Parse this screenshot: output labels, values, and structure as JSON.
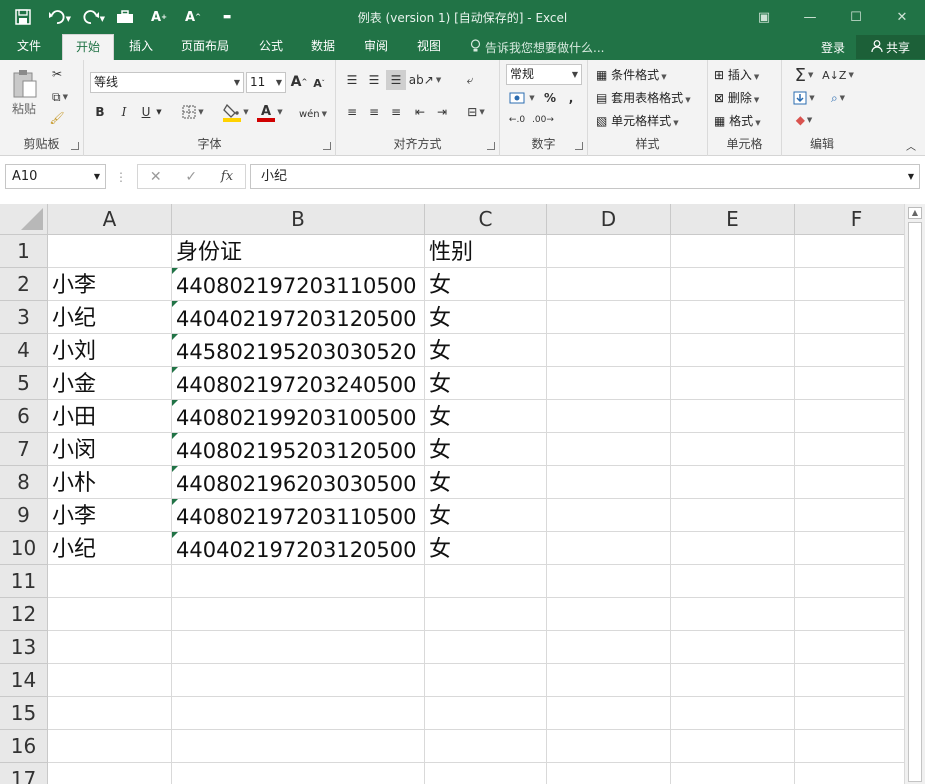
{
  "window": {
    "title": "例表 (version 1) [自动保存的] - Excel"
  },
  "tabs": [
    "文件",
    "开始",
    "插入",
    "页面布局",
    "公式",
    "数据",
    "审阅",
    "视图"
  ],
  "active_tab": "开始",
  "tell_me": "告诉我您想要做什么...",
  "account": {
    "login": "登录",
    "share": "共享"
  },
  "ribbon": {
    "clipboard": {
      "paste": "粘贴",
      "label": "剪贴板"
    },
    "font": {
      "name": "等线",
      "size": "11",
      "label": "字体",
      "bold": "B",
      "italic": "I",
      "underline": "U"
    },
    "alignment": {
      "label": "对齐方式"
    },
    "number": {
      "format": "常规",
      "percent": "%",
      "comma": ",",
      "label": "数字"
    },
    "styles": {
      "conditional": "条件格式",
      "table": "套用表格格式",
      "cell": "单元格样式",
      "label": "样式"
    },
    "cells": {
      "insert": "插入",
      "delete": "删除",
      "format": "格式",
      "label": "单元格"
    },
    "editing": {
      "label": "编辑"
    }
  },
  "formula_bar": {
    "name_box": "A10",
    "fx": "fx",
    "content": "小纪"
  },
  "columns": [
    "A",
    "B",
    "C",
    "D",
    "E",
    "F"
  ],
  "rows": [
    "1",
    "2",
    "3",
    "4",
    "5",
    "6",
    "7",
    "8",
    "9",
    "10",
    "11",
    "12",
    "13",
    "14",
    "15",
    "16",
    "17"
  ],
  "cells": [
    [
      "",
      "身份证",
      "性别"
    ],
    [
      "小李",
      "440802197203110500",
      "女"
    ],
    [
      "小纪",
      "440402197203120500",
      "女"
    ],
    [
      "小刘",
      "445802195203030520",
      "女"
    ],
    [
      "小金",
      "440802197203240500",
      "女"
    ],
    [
      "小田",
      "440802199203100500",
      "女"
    ],
    [
      "小闵",
      "440802195203120500",
      "女"
    ],
    [
      "小朴",
      "440802196203030500",
      "女"
    ],
    [
      "小李",
      "440802197203110500",
      "女"
    ],
    [
      "小纪",
      "440402197203120500",
      "女"
    ]
  ]
}
